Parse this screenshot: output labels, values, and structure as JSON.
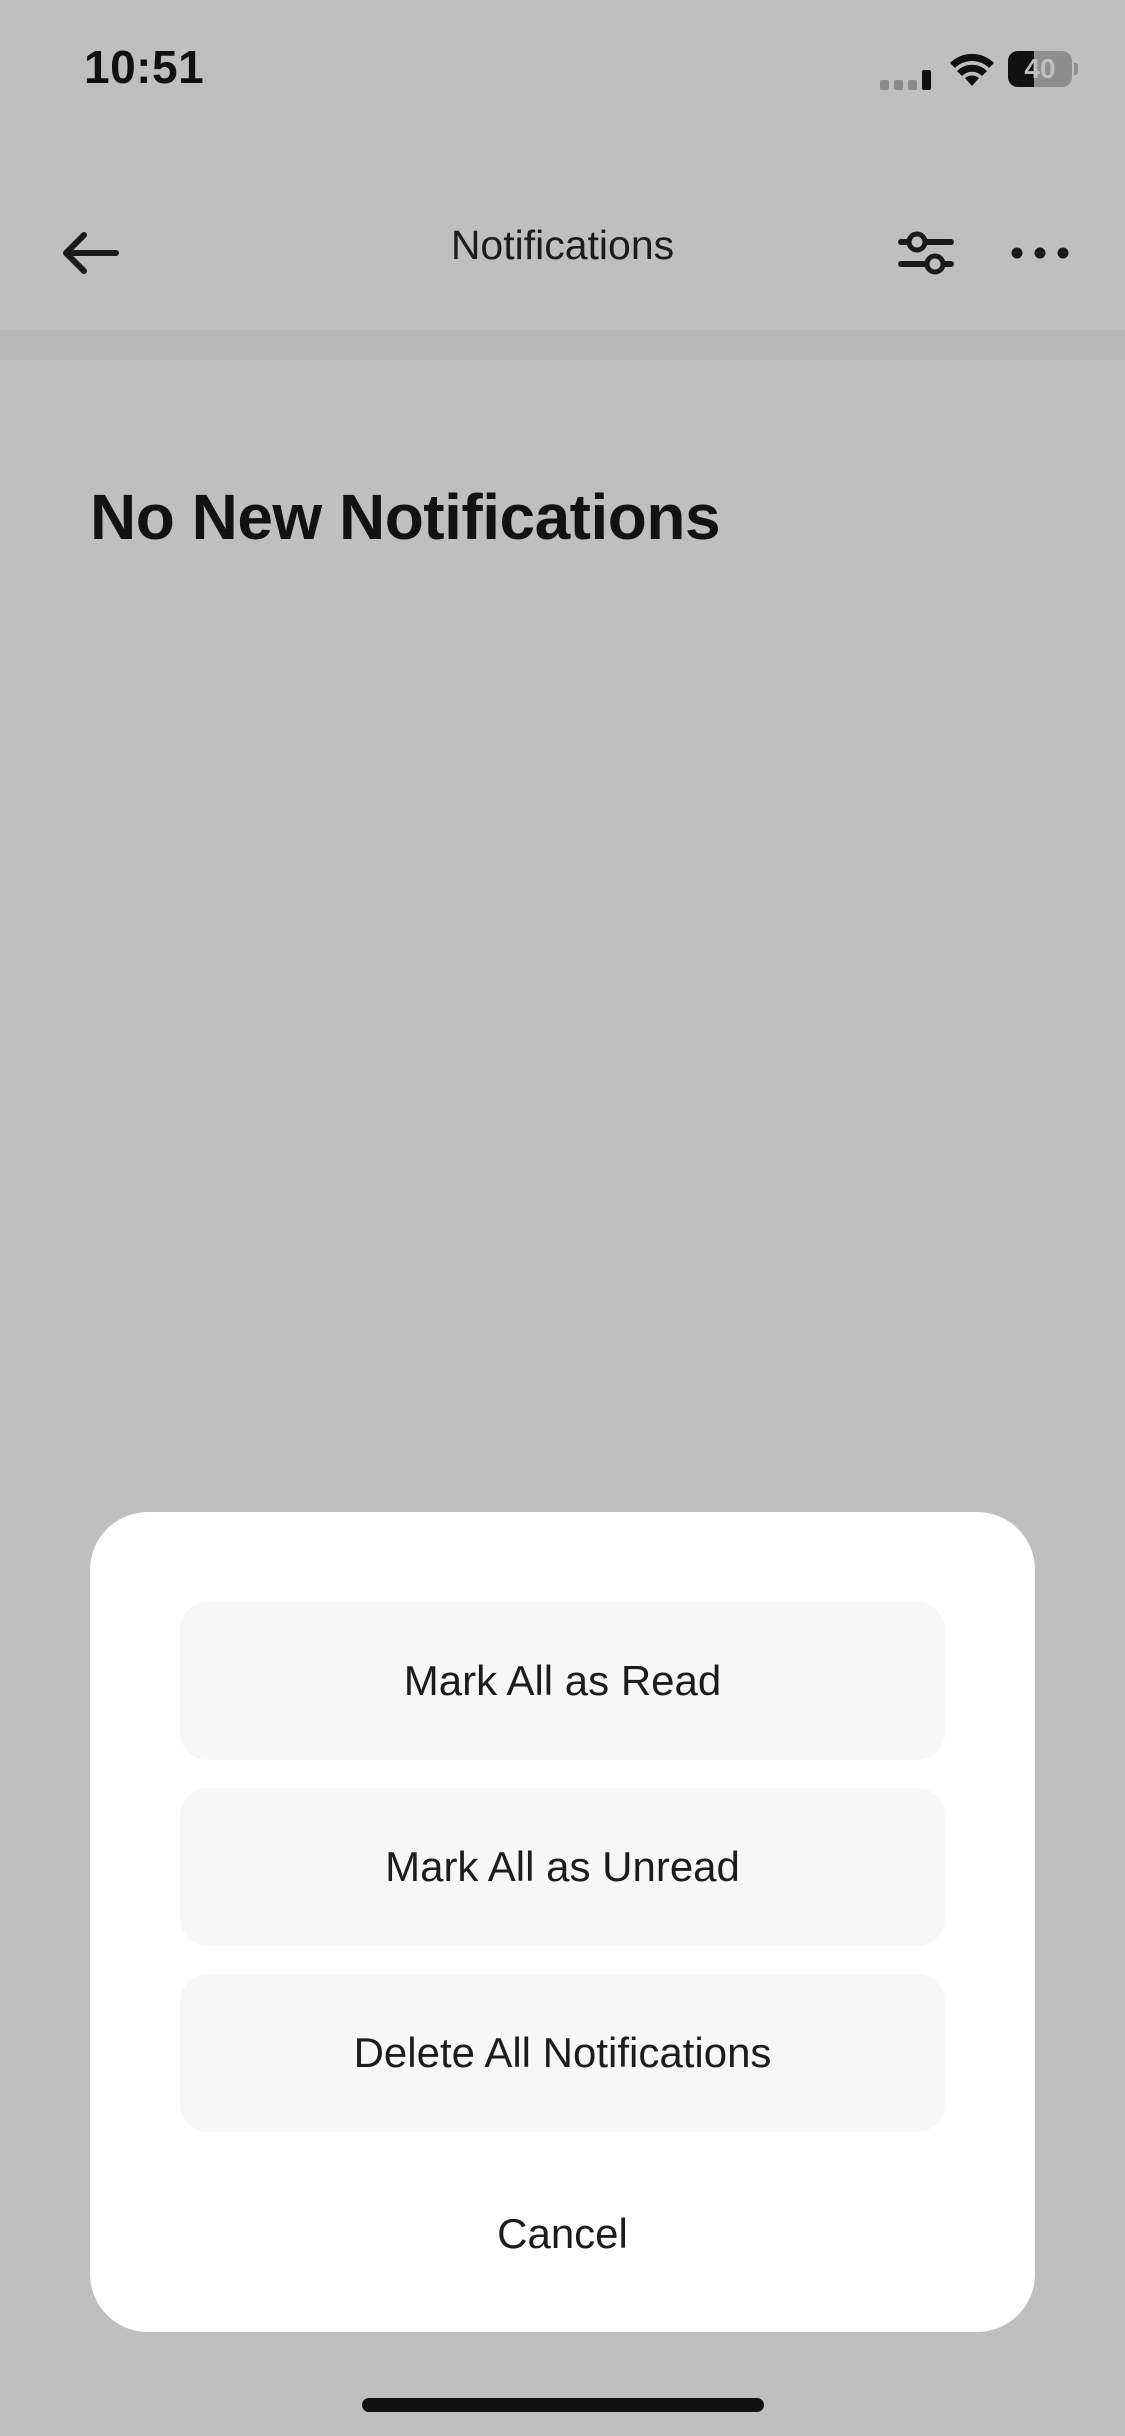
{
  "status_bar": {
    "time": "10:51",
    "battery_level": "40",
    "battery_fraction": 0.4,
    "icons": [
      "cellular-signal-icon",
      "wifi-icon",
      "battery-icon"
    ]
  },
  "nav": {
    "title": "Notifications",
    "back_icon": "arrow-left-icon",
    "filter_icon": "sliders-icon",
    "more_icon": "ellipsis-icon"
  },
  "main": {
    "empty_title": "No New Notifications"
  },
  "action_sheet": {
    "options": [
      {
        "label": "Mark All as Read"
      },
      {
        "label": "Mark All as Unread"
      },
      {
        "label": "Delete All Notifications"
      }
    ],
    "cancel_label": "Cancel"
  },
  "colors": {
    "background": "#bfbfbf",
    "sheet": "#ffffff",
    "option_background": "#f7f7f7",
    "text": "#1c1c1c"
  }
}
